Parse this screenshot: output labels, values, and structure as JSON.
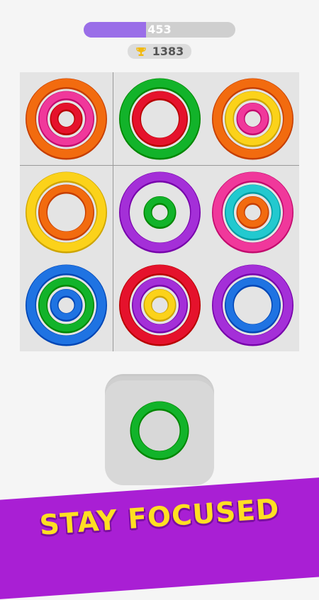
{
  "hud": {
    "current_score": "453",
    "progress_fraction": 0.41,
    "best_score": "1383",
    "trophy_icon": "trophy-icon"
  },
  "board": {
    "cells": [
      [
        [
          "orange",
          "pink",
          "red"
        ],
        [
          "green",
          "red"
        ],
        [
          "orange",
          "yellow",
          "pink"
        ]
      ],
      [
        [
          "yellow",
          "orange"
        ],
        [
          "purple",
          null,
          "green"
        ],
        [
          "pink",
          "cyan",
          "orange"
        ]
      ],
      [
        [
          "blue",
          "green",
          "blue"
        ],
        [
          "red",
          "purple",
          "yellow"
        ],
        [
          "purple",
          "blue"
        ]
      ]
    ]
  },
  "tray": {
    "piece": [
      null,
      "green"
    ]
  },
  "banner": {
    "text": "STAY FOCUSED"
  },
  "colors": {
    "orange": "#f26b0f",
    "pink": "#f0389b",
    "red": "#e5122c",
    "green": "#12b32a",
    "yellow": "#fbd21a",
    "purple": "#a42fd8",
    "cyan": "#22c9cf",
    "blue": "#1f73e2",
    "progress": "#9a6ee8",
    "banner": "#a91fd4",
    "banner_text": "#ffdf22"
  }
}
